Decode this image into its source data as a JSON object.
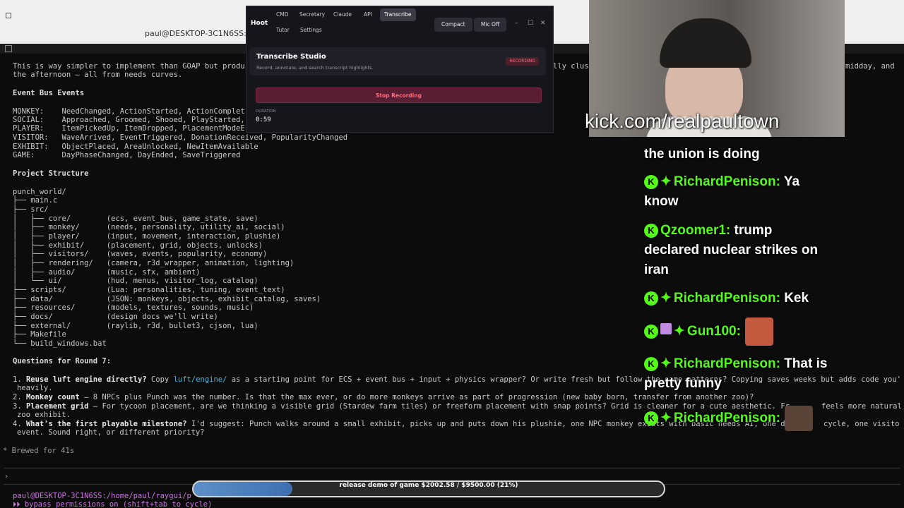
{
  "terminal": {
    "title": "paul@DESKTOP-3C1N6SS: ~/ra",
    "lines": {
      "l0": "This is way simpler to implement than GOAP but produ",
      "l0b": "lly clus",
      "l0c": "midday, and",
      "l1": "the afternoon — all from needs curves.",
      "h_events": "Event Bus Events",
      "ev1": "MONKEY:    NeedChanged, ActionStarted, ActionComplet",
      "ev2": "SOCIAL:    Approached, Groomed, Shooed, PlayStarted,",
      "ev3": "PLAYER:    ItemPickedUp, ItemDropped, PlacementModeE",
      "ev4": "VISITOR:   WaveArrived, EventTriggered, DonationReceived, PopularityChanged",
      "ev5": "EXHIBIT:   ObjectPlaced, AreaUnlocked, NewItemAvailable",
      "ev6": "GAME:      DayPhaseChanged, DayEnded, SaveTriggered",
      "h_struct": "Project Structure",
      "s0": "punch_world/",
      "s1": "├── main.c",
      "s2": "├── src/",
      "s3": "│   ├── core/        (ecs, event_bus, game_state, save)",
      "s4": "│   ├── monkey/      (needs, personality, utility_ai, social)",
      "s5": "│   ├── player/      (input, movement, interaction, plushie)",
      "s6": "│   ├── exhibit/     (placement, grid, objects, unlocks)",
      "s7": "│   ├── visitors/    (waves, events, popularity, economy)",
      "s8": "│   ├── rendering/   (camera, r3d_wrapper, animation, lighting)",
      "s9": "│   ├── audio/       (music, sfx, ambient)",
      "s10": "│   └── ui/          (hud, menus, visitor_log, catalog)",
      "s11": "├── scripts/         (Lua: personalities, tuning, event_text)",
      "s12": "├── data/            (JSON: monkeys, objects, exhibit_catalog, saves)",
      "s13": "├── resources/       (models, textures, sounds, music)",
      "s14": "├── docs/            (design docs we'll write)",
      "s15": "├── external/        (raylib, r3d, bullet3, cjson, lua)",
      "s16": "├── Makefile",
      "s17": "└── build_windows.bat",
      "h_questions": "Questions for Round 7:",
      "q1_num": "1. ",
      "q1_bold": "Reuse luft engine directly?",
      "q1_a": " Copy ",
      "q1_link": "luft/engine/",
      "q1_b": " as a starting point for ECS + event bus + input + physics wrapper? Or write fresh but follow the same patterns? Copying saves weeks but adds code you'",
      "q1_c": "heavily.",
      "q2_num": "2. ",
      "q2_bold": "Monkey count",
      "q2_a": " — 8 NPCs plus Punch was the number. Is that the max ever, or do more monkeys arrive as part of progression (new baby born, transfer from another zoo)?",
      "q3_num": "3. ",
      "q3_bold": "Placement grid",
      "q3_a": " — For tycoon placement, are we thinking a visible grid (Stardew farm tiles) or freeform placement with snap points? Grid is cleaner for a cute aesthetic. Fr",
      "q3_tail": "feels more natural",
      "q3_c": "zoo exhibit.",
      "q4_num": "4. ",
      "q4_bold": "What's the first playable milestone?",
      "q4_a": " I'd suggest: Punch walks around a small exhibit, picks up and puts down his plushie, one NPC monkey exists with basic needs AI, one da",
      "q4_tail": "cycle, one visito",
      "q4_c": "event. Sound right, or different priority?",
      "brewed": "* Brewed for 41s"
    },
    "prompt_caret": "›",
    "prompt_path": "paul@DESKTOP-3C1N6SS:/home/paul/raygui/p",
    "bypass": "⏵⏵ bypass permissions on (shift+tab to cycle)"
  },
  "hoot": {
    "brand": "Hoot",
    "tabs": [
      "CMD",
      "Secretary",
      "Claude",
      "API",
      "Transcribe",
      "Tutor",
      "Settings"
    ],
    "active_tab": "Transcribe",
    "compact_label": "Compact",
    "mic_label": "Mic Off",
    "win_min": "–",
    "win_max": "☐",
    "win_close": "✕",
    "card_title": "Transcribe Studio",
    "card_subtitle": "Record, annotate, and search transcript highlights.",
    "recording_badge": "RECORDING",
    "stop_label": "Stop Recording",
    "duration_label": "DURATION",
    "duration_value": "0:59"
  },
  "webcam": {
    "url": "kick.com/realpaultown"
  },
  "chat": [
    {
      "user": "",
      "text": "the union is doing",
      "badges": []
    },
    {
      "user": "RichardPenison:",
      "text": "Ya know",
      "badges": [
        "kick",
        "diamond"
      ]
    },
    {
      "user": "Qzoomer1:",
      "text": "trump declared nuclear strikes on iran",
      "badges": [
        "kick"
      ]
    },
    {
      "user": "RichardPenison:",
      "text": "Kek",
      "badges": [
        "kick",
        "diamond"
      ]
    },
    {
      "user": "Gun100:",
      "text": "",
      "badges": [
        "kick",
        "gift",
        "diamond"
      ],
      "emote": "face-emote"
    },
    {
      "user": "RichardPenison:",
      "text": "That is pretty funny",
      "badges": [
        "kick",
        "diamond"
      ]
    },
    {
      "user": "RichardPenison:",
      "text": "",
      "badges": [
        "kick",
        "diamond"
      ],
      "emote": "face-emote"
    }
  ],
  "goal": {
    "label": "release demo of game $2002.58 / $9500.00 (21%)",
    "progress": 0.21
  },
  "colors": {
    "kick_green": "#53fc18",
    "goal_fill": "#4f7fc0",
    "recording_red": "#ff6b7e"
  }
}
